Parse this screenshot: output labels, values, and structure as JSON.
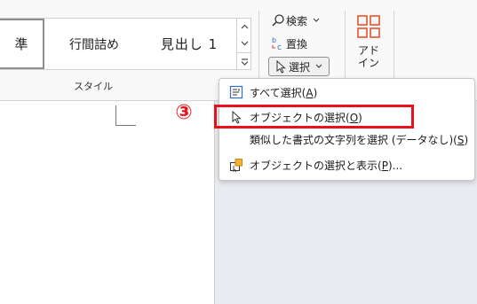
{
  "ribbon": {
    "styles": {
      "items": [
        {
          "label": "準"
        },
        {
          "label": "行間詰め"
        },
        {
          "label": "見出し 1"
        }
      ],
      "group_label": "スタイル"
    },
    "editing": {
      "find_label": "検索",
      "replace_label": "置換",
      "select_label": "選択"
    },
    "addins": {
      "label": "アド\nイン",
      "accent": "#e4522d"
    }
  },
  "select_menu": {
    "items": [
      {
        "label": "すべて選択(",
        "key": "A",
        "suffix": ")"
      },
      {
        "label": "オブジェクトの選択(",
        "key": "O",
        "suffix": ")"
      },
      {
        "label": "類似した書式の文字列を選択 (データなし)(",
        "key": "S",
        "suffix": ")"
      },
      {
        "label": "オブジェクトの選択と表示(",
        "key": "P",
        "suffix": ")..."
      }
    ]
  },
  "annotation": {
    "step": "③",
    "color": "#e8101a"
  }
}
